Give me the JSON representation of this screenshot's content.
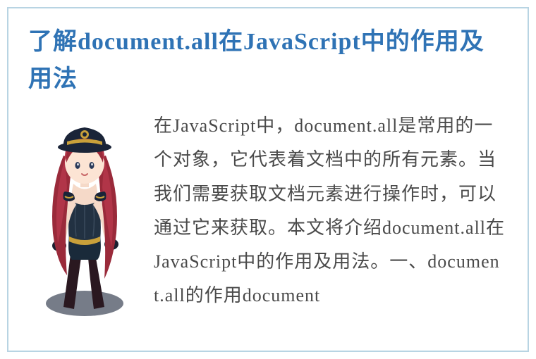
{
  "title": "了解document.all在JavaScript中的作用及用法",
  "body": "在JavaScript中，document.all是常用的一个对象，它代表着文档中的所有元素。当我们需要获取文档元素进行操作时，可以通过它来获取。本文将介绍document.all在JavaScript中的作用及用法。一、document.all的作用document"
}
